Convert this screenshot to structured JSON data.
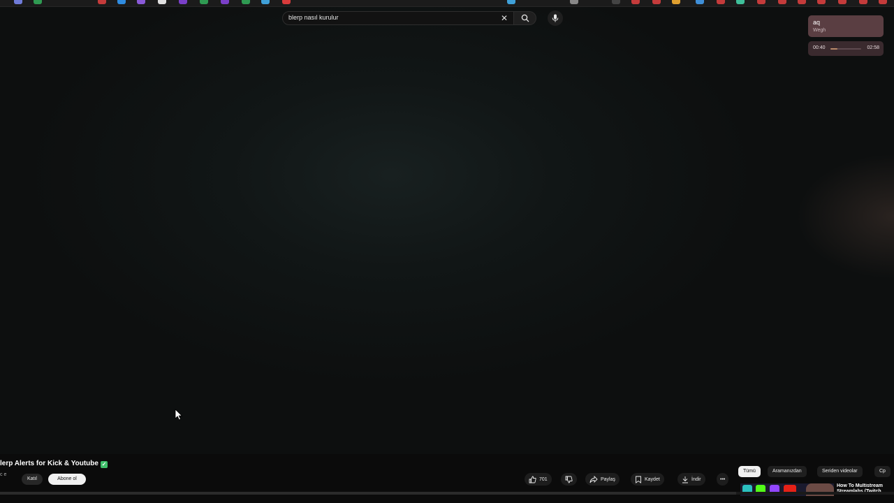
{
  "search": {
    "query": "blerp nasıl kurulur"
  },
  "now_playing": {
    "title": "aq",
    "artist": "Wegh",
    "elapsed": "00:40",
    "total": "02:58",
    "progress_fraction": 0.22
  },
  "video": {
    "title": "lerp Alerts for Kick & Youtube",
    "channel_fragment": "c e",
    "join_label": "Katıl",
    "subscribe_label": "Abone ol"
  },
  "actions": {
    "like_count": "701",
    "share_label": "Paylaş",
    "save_label": "Kaydet",
    "download_label": "İndir"
  },
  "chips": [
    "Tümü",
    "Aramanızdan",
    "Seriden videolar",
    "Cp"
  ],
  "recommended": {
    "title_line1": "How To Multistream",
    "title_line2": "Streamlabs (Twitch"
  },
  "colors": {
    "verified": "#3fbf6a",
    "now_playing_bg": "#5a3e42"
  }
}
